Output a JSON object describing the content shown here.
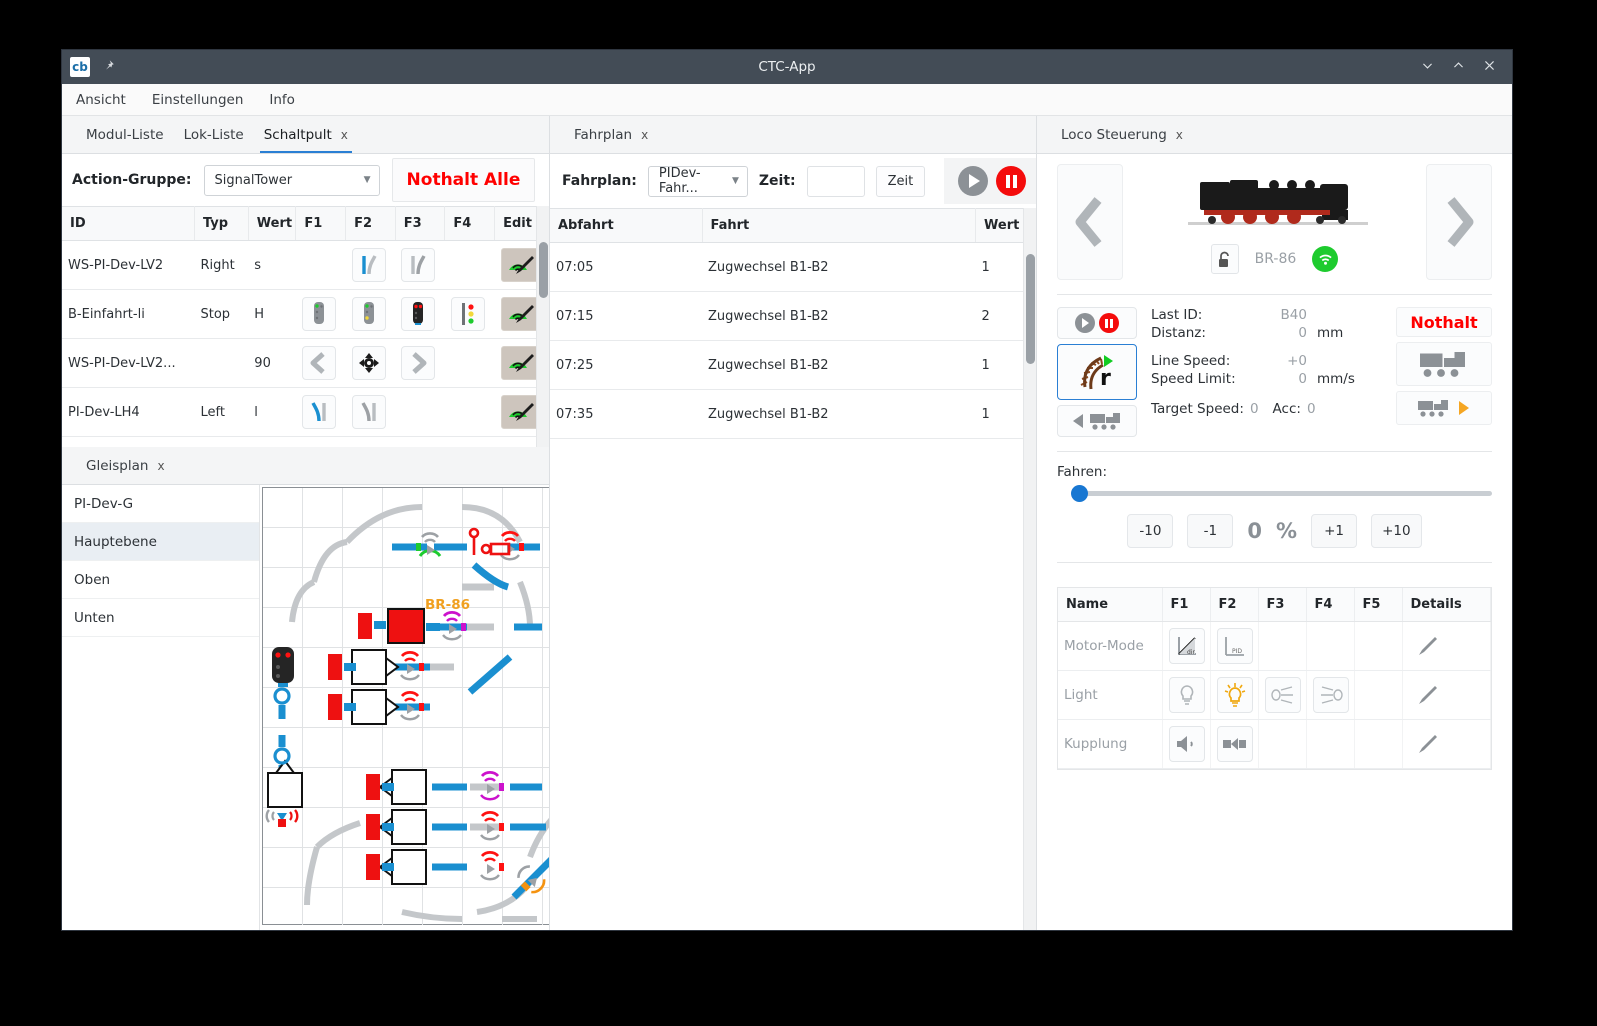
{
  "window": {
    "title": "CTC-App",
    "logo_text": "cb",
    "pin_icon": "pin-icon",
    "minimize_icon": "chevron-down-icon",
    "maximize_icon": "chevron-up-icon",
    "close_icon": "close-icon"
  },
  "menubar": {
    "items": [
      "Ansicht",
      "Einstellungen",
      "Info"
    ]
  },
  "left": {
    "tabs": [
      {
        "label": "Modul-Liste",
        "active": false,
        "closable": false
      },
      {
        "label": "Lok-Liste",
        "active": false,
        "closable": false
      },
      {
        "label": "Schaltpult",
        "active": true,
        "closable": true,
        "close_label": "x"
      }
    ],
    "toolbar": {
      "group_label": "Action-Gruppe:",
      "group_value": "SignalTower",
      "caret_icon": "chevron-down-icon",
      "nothalt_alle": "Nothalt Alle"
    },
    "table": {
      "headers": [
        "ID",
        "Typ",
        "Wert",
        "F1",
        "F2",
        "F3",
        "F4",
        "Edit"
      ],
      "rows": [
        {
          "id": "WS-PI-Dev-LV2",
          "typ": "Right",
          "wert": "s",
          "f1": "",
          "f2": "turnout-straight-icon",
          "f3": "turnout-curved-icon",
          "f4": "",
          "edit": "edit-signal-icon"
        },
        {
          "id": "B-Einfahrt-li",
          "typ": "Stop",
          "wert": "H",
          "f1": "signal-green-icon",
          "f2": "signal-yellow-icon",
          "f3": "signal-red-icon",
          "f4": "signal-tower-icon",
          "edit": "edit-signal-icon"
        },
        {
          "id": "WS-PI-Dev-LV2...",
          "typ": "",
          "wert": "90",
          "f1": "arrow-left-icon",
          "f2": "center-target-icon",
          "f3": "arrow-right-icon",
          "f4": "",
          "edit": "edit-signal-icon"
        },
        {
          "id": "PI-Dev-LH4",
          "typ": "Left",
          "wert": "l",
          "f1": "turnout-left-blue-icon",
          "f2": "turnout-left-gray-icon",
          "f3": "",
          "f4": "",
          "edit": "edit-signal-icon"
        }
      ]
    },
    "gleisplan": {
      "tab_label": "Gleisplan",
      "tab_close": "x",
      "levels": [
        {
          "label": "PI-Dev-G",
          "selected": false
        },
        {
          "label": "Hauptebene",
          "selected": true
        },
        {
          "label": "Oben",
          "selected": false
        },
        {
          "label": "Unten",
          "selected": false
        }
      ],
      "loco_marker": "BR-86"
    }
  },
  "middle": {
    "tab": {
      "label": "Fahrplan",
      "close_label": "x"
    },
    "toolbar": {
      "plan_label": "Fahrplan:",
      "plan_value": "PIDev-Fahr...",
      "caret_icon": "chevron-down-icon",
      "time_label": "Zeit:",
      "time_value": "",
      "time_button": "Zeit",
      "play_icon": "play-icon",
      "pause_icon": "pause-icon"
    },
    "table": {
      "headers": [
        "Abfahrt",
        "Fahrt",
        "Wert"
      ],
      "rows": [
        {
          "abfahrt": "07:05",
          "fahrt": "Zugwechsel B1-B2",
          "wert": "1"
        },
        {
          "abfahrt": "07:15",
          "fahrt": "Zugwechsel B1-B2",
          "wert": "2"
        },
        {
          "abfahrt": "07:25",
          "fahrt": "Zugwechsel B1-B2",
          "wert": "1"
        },
        {
          "abfahrt": "07:35",
          "fahrt": "Zugwechsel B1-B2",
          "wert": "1"
        }
      ]
    }
  },
  "right": {
    "tab": {
      "label": "Loco Steuerung",
      "close_label": "x"
    },
    "loco": {
      "prev_icon": "chevron-left-icon",
      "next_icon": "chevron-right-icon",
      "image_alt": "locomotive-photo",
      "lock_icon": "unlock-icon",
      "name": "BR-86",
      "wifi_icon": "wifi-green-icon",
      "playpause_icon": "play-pause-icon",
      "track_dir_icon": "track-direction-icon",
      "reverse_icon": "loco-reverse-icon",
      "stats": [
        {
          "key": "Last ID:",
          "value": "B40",
          "unit": ""
        },
        {
          "key": "Distanz:",
          "value": "0",
          "unit": "mm"
        },
        {
          "key": "Line Speed:",
          "value": "+0",
          "unit": ""
        },
        {
          "key": "Speed Limit:",
          "value": "0",
          "unit": "mm/s"
        }
      ],
      "target_line": {
        "k1": "Target Speed:",
        "v1": "0",
        "k2": "Acc:",
        "v2": "0"
      },
      "nothalt": "Nothalt",
      "loco_big_icon": "locomotive-icon",
      "loco_forward_icon": "locomotive-forward-icon"
    },
    "fahren": {
      "label": "Fahren:",
      "slider_value": 0,
      "buttons": [
        "-10",
        "-1",
        "+1",
        "+10"
      ],
      "value": "0",
      "unit": "%"
    },
    "functions": {
      "headers": [
        "Name",
        "F1",
        "F2",
        "F3",
        "F4",
        "F5",
        "Details"
      ],
      "rows": [
        {
          "name": "Motor-Mode",
          "f1": "motor-dir-icon",
          "f2": "motor-pid-icon",
          "f3": "",
          "f4": "",
          "f5": "",
          "details": "pencil-icon"
        },
        {
          "name": "Light",
          "f1": "bulb-off-icon",
          "f2": "bulb-on-icon",
          "f3": "headlight-left-icon",
          "f4": "headlight-right-icon",
          "f5": "",
          "details": "pencil-icon"
        },
        {
          "name": "Kupplung",
          "f1": "horn-icon",
          "f2": "coupler-icon",
          "f3": "",
          "f4": "",
          "f5": "",
          "details": "pencil-icon"
        }
      ]
    }
  },
  "colors": {
    "accent": "#2a7fd4",
    "danger": "#ff0000",
    "titlebar": "#434c56",
    "track_active": "#1a8fd0",
    "track_idle": "#c4c7ca",
    "loco_marker": "#f0a020"
  }
}
